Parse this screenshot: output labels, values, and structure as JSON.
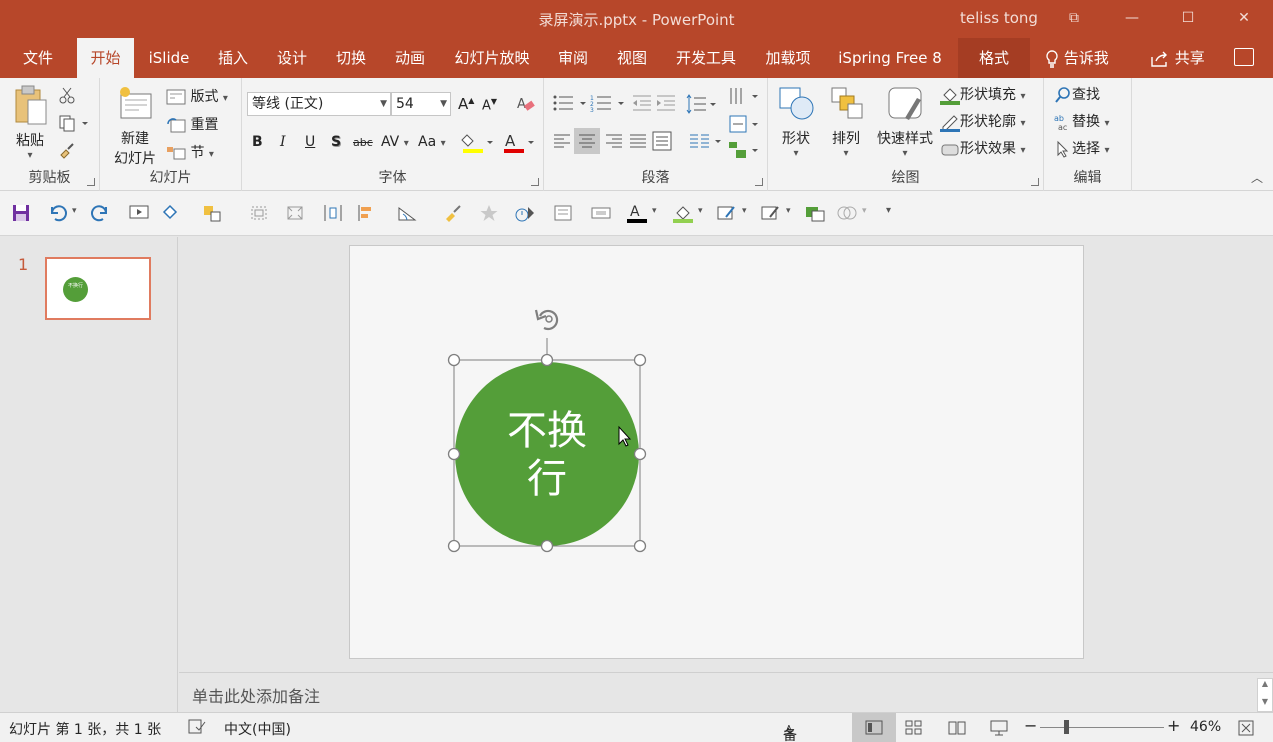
{
  "window": {
    "title": "录屏演示.pptx  -  PowerPoint",
    "user": "teliss tong",
    "controls": {
      "restore": "⧉",
      "minimize": "—",
      "maximize": "☐",
      "close": "✕"
    }
  },
  "tabs": [
    {
      "label": "文件"
    },
    {
      "label": "开始"
    },
    {
      "label": "iSlide"
    },
    {
      "label": "插入"
    },
    {
      "label": "设计"
    },
    {
      "label": "切换"
    },
    {
      "label": "动画"
    },
    {
      "label": "幻灯片放映"
    },
    {
      "label": "审阅"
    },
    {
      "label": "视图"
    },
    {
      "label": "开发工具"
    },
    {
      "label": "加载项"
    },
    {
      "label": "iSpring Free 8"
    },
    {
      "label": "格式"
    }
  ],
  "tell_me": "告诉我",
  "share": "共享",
  "ribbon": {
    "clipboard": {
      "paste": "粘贴",
      "label": "剪贴板"
    },
    "slides": {
      "new_slide_1": "新建",
      "new_slide_2": "幻灯片",
      "layout": "版式",
      "reset": "重置",
      "section": "节",
      "label": "幻灯片"
    },
    "font": {
      "font_name": "等线 (正文)",
      "font_size": "54",
      "bold": "B",
      "italic": "I",
      "underline": "U",
      "shadow": "S",
      "strike": "abc",
      "spacing": "AV",
      "case": "Aa",
      "label": "字体"
    },
    "paragraph": {
      "label": "段落"
    },
    "drawing": {
      "shapes": "形状",
      "arrange": "排列",
      "quick_styles": "快速样式",
      "fill": "形状填充",
      "outline": "形状轮廓",
      "effects": "形状效果",
      "label": "绘图"
    },
    "editing": {
      "find": "查找",
      "replace": "替换",
      "select": "选择",
      "label": "编辑"
    }
  },
  "thumbnail": {
    "number": "1",
    "text": "不换行"
  },
  "slide": {
    "shape_text_line1": "不换",
    "shape_text_line2": "行",
    "shape_color": "#549e39"
  },
  "notes_placeholder": "单击此处添加备注",
  "status": {
    "slide_info": "幻灯片 第 1 张，共 1 张",
    "language": "中文(中国)",
    "notes": "备注",
    "zoom_minus": "−",
    "zoom_plus": "+",
    "zoom": "46%"
  },
  "colors": {
    "accent": "#b7472a",
    "shape_green": "#549e39"
  }
}
